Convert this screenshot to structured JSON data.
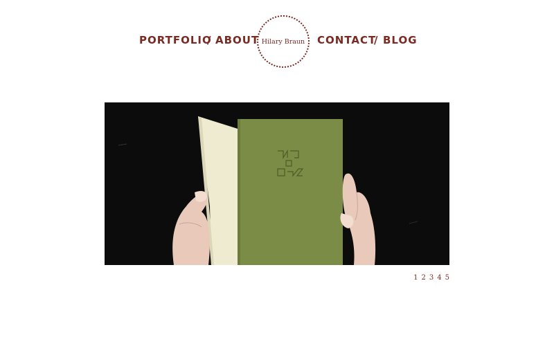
{
  "nav": {
    "portfolio": "PORTFOLIO",
    "about": "ABOUT",
    "contact": "CONTACT",
    "blog": "BLOG",
    "separator": "/"
  },
  "logo": {
    "text": "Hilary Braun"
  },
  "slideshow": {
    "image_description_icon": "book-photo",
    "pages": [
      "1",
      "2",
      "3",
      "4",
      "5"
    ]
  },
  "colors": {
    "accent": "#7a2a22",
    "background": "#ffffff",
    "slide_background": "#0c0c0c",
    "book_cover": "#7a8c45"
  }
}
